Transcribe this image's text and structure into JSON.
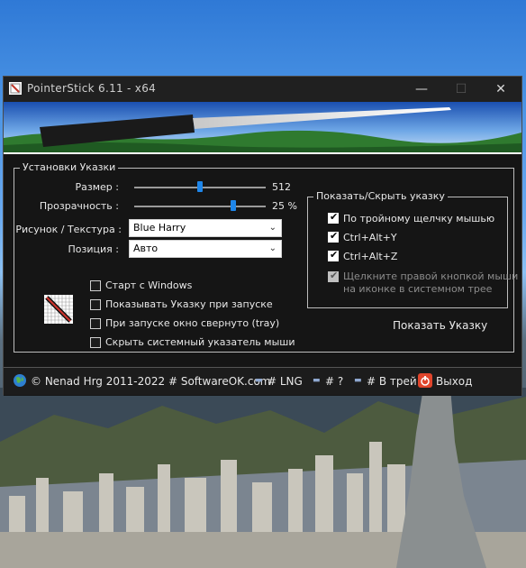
{
  "window": {
    "title": "PointerStick 6.11 - x64",
    "minimize_glyph": "—",
    "maximize_glyph": "☐",
    "close_glyph": "✕"
  },
  "settings": {
    "legend": "Установки Указки",
    "size": {
      "label": "Размер :",
      "value": "512",
      "level": 0.5
    },
    "transparency": {
      "label": "Прозрачность :",
      "value": "25 %",
      "level": 0.75
    },
    "texture": {
      "label": "Рисунок / Текстура :",
      "selected": "Blue Harry"
    },
    "position": {
      "label": "Позиция :",
      "selected": "Авто"
    },
    "checkboxes": [
      {
        "label": "Старт с Windows",
        "checked": false
      },
      {
        "label": "Показывать Указку при запуске",
        "checked": false
      },
      {
        "label": "При запуске окно свернуто (tray)",
        "checked": false
      },
      {
        "label": "Скрыть системный указатель мыши",
        "checked": false
      }
    ]
  },
  "show_hide": {
    "legend": "Показать/Скрыть указку",
    "options": [
      {
        "label": "По тройному щелчку мышью",
        "checked": true
      },
      {
        "label": "Ctrl+Alt+Y",
        "checked": true
      },
      {
        "label": "Ctrl+Alt+Z",
        "checked": true
      },
      {
        "label_line1": "Щелкните правой кнопкой мыши",
        "label_line2": "на иконке в системном трее",
        "checked": true,
        "disabled": true
      }
    ],
    "show_button": "Показать Указку"
  },
  "statusbar": {
    "copyright": "© Nenad Hrg 2011-2022 # SoftwareOK.com",
    "lng": "# LNG",
    "help": "# ?",
    "tray": "# В трей",
    "exit": "Выход"
  },
  "colors": {
    "accent": "#1e86ea",
    "window_bg": "#1c1c1c",
    "exit_icon": "#e0452c"
  }
}
